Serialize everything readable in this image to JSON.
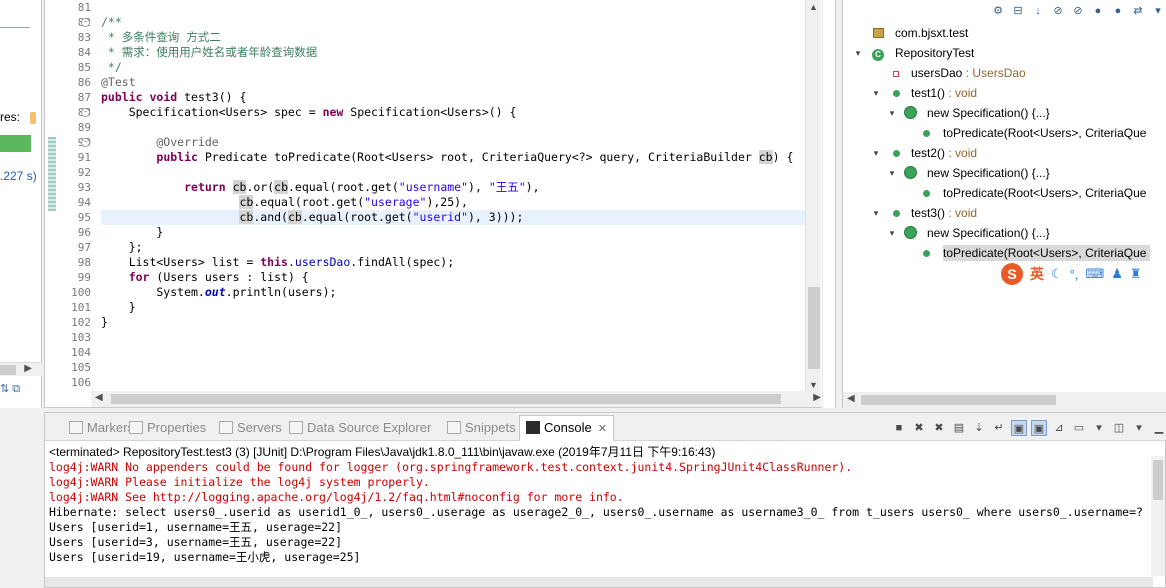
{
  "left_panel": {
    "label": "res:",
    "time": ".227 s)"
  },
  "editor": {
    "line_numbers": [
      "81",
      "82",
      "83",
      "84",
      "85",
      "86",
      "87",
      "88",
      "89",
      "90",
      "91",
      "92",
      "93",
      "94",
      "95",
      "96",
      "97",
      "98",
      "99",
      "100",
      "101",
      "102",
      "103",
      "104",
      "105",
      "106"
    ],
    "lines": [
      {
        "n": "81",
        "t": ""
      },
      {
        "n": "82",
        "t": "/**"
      },
      {
        "n": "83",
        "t": " * 多条件查询 方式二"
      },
      {
        "n": "84",
        "t": " * 需求：使用用户姓名或者年龄查询数据"
      },
      {
        "n": "85",
        "t": " */"
      },
      {
        "n": "86",
        "t": "@Test"
      },
      {
        "n": "87",
        "t": "public void test3() {"
      },
      {
        "n": "88",
        "t": "    Specification<Users> spec = new Specification<Users>() {"
      },
      {
        "n": "89",
        "t": ""
      },
      {
        "n": "90",
        "t": "        @Override"
      },
      {
        "n": "91",
        "t": "        public Predicate toPredicate(Root<Users> root, CriteriaQuery<?> query, CriteriaBuilder cb) {"
      },
      {
        "n": "92",
        "t": ""
      },
      {
        "n": "93",
        "t": "            return cb.or(cb.equal(root.get(\"username\"), \"王五\"),"
      },
      {
        "n": "94",
        "t": "                    cb.equal(root.get(\"userage\"),25),"
      },
      {
        "n": "95",
        "t": "                    cb.and(cb.equal(root.get(\"userid\"), 3)));"
      },
      {
        "n": "96",
        "t": "        }"
      },
      {
        "n": "97",
        "t": "    };"
      },
      {
        "n": "98",
        "t": "    List<Users> list = this.usersDao.findAll(spec);"
      },
      {
        "n": "99",
        "t": "    for (Users users : list) {"
      },
      {
        "n": "100",
        "t": "        System.out.println(users);"
      },
      {
        "n": "101",
        "t": "    }"
      },
      {
        "n": "102",
        "t": "}"
      },
      {
        "n": "103",
        "t": ""
      },
      {
        "n": "104",
        "t": ""
      },
      {
        "n": "105",
        "t": ""
      },
      {
        "n": "106",
        "t": ""
      }
    ]
  },
  "outline": {
    "toolbar_icons": [
      "collapse-all-icon",
      "hide-fields-icon",
      "sort-icon",
      "hide-static-icon",
      "hide-nonpublic-icon",
      "hide-local-types-icon",
      "green-dot-icon",
      "link-icon",
      "menu-icon"
    ],
    "items": [
      {
        "label": "com.bjsxt.test",
        "type": ""
      },
      {
        "label": "RepositoryTest",
        "type": ""
      },
      {
        "label": "usersDao",
        "type": " : UsersDao"
      },
      {
        "label": "test1()",
        "type": " : void"
      },
      {
        "label": "new Specification() {...}",
        "type": ""
      },
      {
        "label": "toPredicate(Root<Users>, CriteriaQue",
        "type": ""
      },
      {
        "label": "test2()",
        "type": " : void"
      },
      {
        "label": "new Specification() {...}",
        "type": ""
      },
      {
        "label": "toPredicate(Root<Users>, CriteriaQue",
        "type": ""
      },
      {
        "label": "test3()",
        "type": " : void"
      },
      {
        "label": "new Specification() {...}",
        "type": ""
      },
      {
        "label": "toPredicate(Root<Users>, CriteriaQue",
        "type": ""
      }
    ],
    "ime": {
      "logo": "S",
      "mode": "英"
    }
  },
  "console": {
    "tabs": [
      {
        "label": "Markers",
        "icon": "markers-icon"
      },
      {
        "label": "Properties",
        "icon": "properties-icon"
      },
      {
        "label": "Servers",
        "icon": "servers-icon"
      },
      {
        "label": "Data Source Explorer",
        "icon": "data-source-icon"
      },
      {
        "label": "Snippets",
        "icon": "snippets-icon"
      },
      {
        "label": "Console",
        "icon": "console-icon"
      }
    ],
    "close_glyph": "✕",
    "terminated": "<terminated> RepositoryTest.test3 (3) [JUnit] D:\\Program Files\\Java\\jdk1.8.0_111\\bin\\javaw.exe (2019年7月11日 下午9:16:43)",
    "output": [
      {
        "text": "log4j:WARN No appenders could be found for logger (org.springframework.test.context.junit4.SpringJUnit4ClassRunner).",
        "err": true
      },
      {
        "text": "log4j:WARN Please initialize the log4j system properly.",
        "err": true
      },
      {
        "text": "log4j:WARN See http://logging.apache.org/log4j/1.2/faq.html#noconfig for more info.",
        "err": true
      },
      {
        "text": "Hibernate: select users0_.userid as userid1_0_, users0_.userage as userage2_0_, users0_.username as username3_0_ from t_users users0_ where users0_.username=?",
        "err": false
      },
      {
        "text": "Users [userid=1, username=王五, userage=22]",
        "err": false
      },
      {
        "text": "Users [userid=3, username=王五, userage=22]",
        "err": false
      },
      {
        "text": "Users [userid=19, username=王小虎, userage=25]",
        "err": false
      }
    ]
  },
  "colors": {
    "keyword": "#7f0055",
    "string": "#2a00ff",
    "comment": "#3f7f5f",
    "error": "#d00000",
    "current_line": "#e8f2fe"
  }
}
